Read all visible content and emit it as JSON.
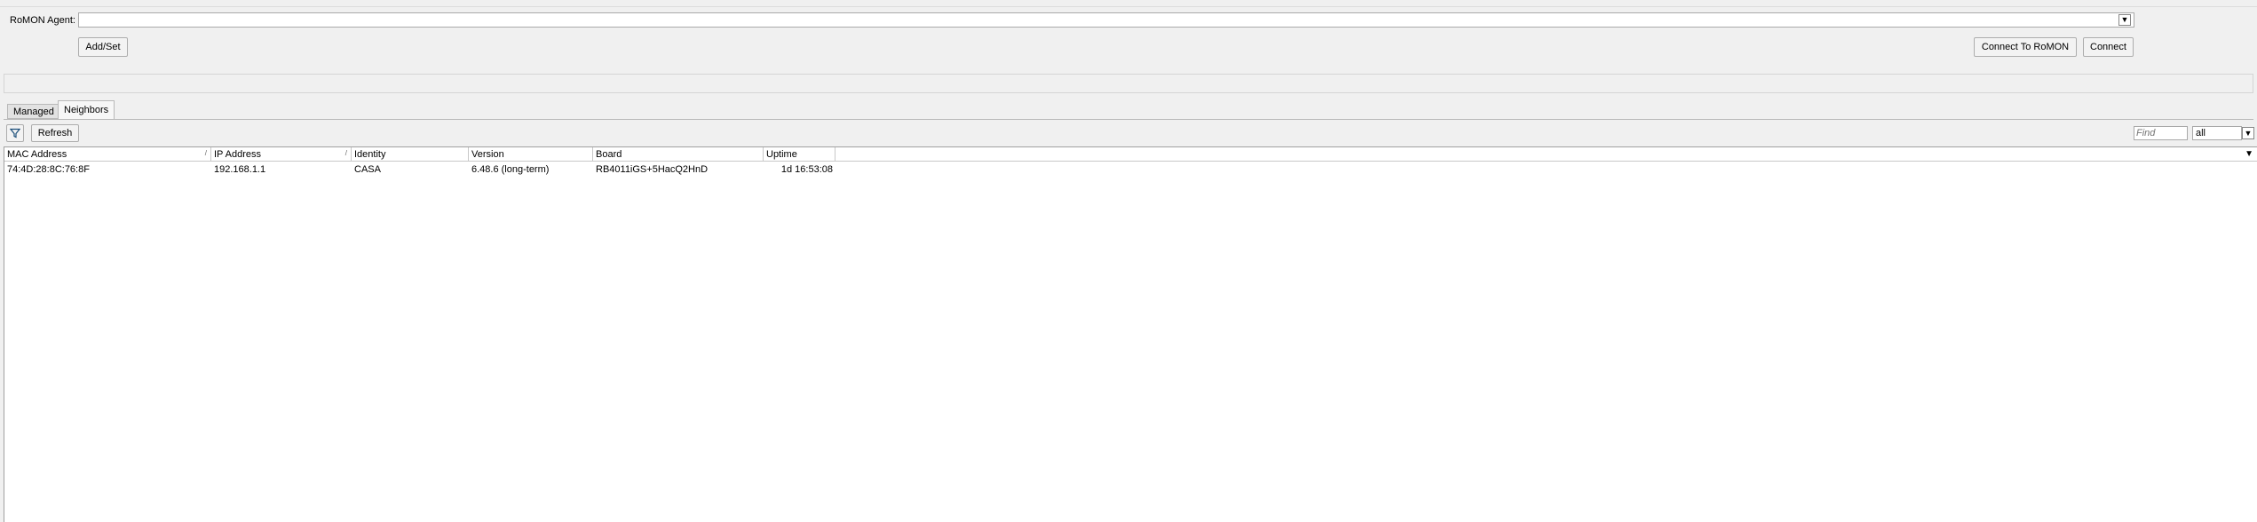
{
  "romon": {
    "agent_label": "RoMON Agent:",
    "agent_value": "",
    "add_set_label": "Add/Set",
    "connect_to_romon_label": "Connect To RoMON",
    "connect_label": "Connect"
  },
  "tabs": [
    {
      "label": "Managed",
      "active": false
    },
    {
      "label": "Neighbors",
      "active": true
    }
  ],
  "toolbar": {
    "filter_icon": "filter-icon",
    "refresh_label": "Refresh",
    "find_placeholder": "Find",
    "scope_value": "all"
  },
  "table": {
    "columns": [
      "MAC Address",
      "IP Address",
      "Identity",
      "Version",
      "Board",
      "Uptime"
    ],
    "rows": [
      {
        "mac": "74:4D:28:8C:76:8F",
        "ip": "192.168.1.1",
        "identity": "CASA",
        "version": "6.48.6 (long-term)",
        "board": "RB4011iGS+5HacQ2HnD",
        "uptime": "1d 16:53:08"
      }
    ]
  }
}
